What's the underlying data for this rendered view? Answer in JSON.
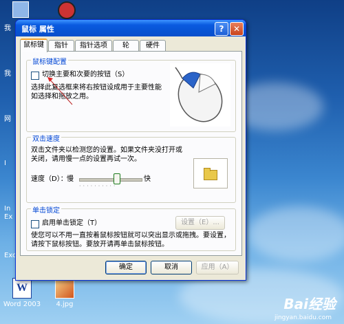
{
  "dialog": {
    "title": "鼠标 属性",
    "help_icon": "?",
    "close_icon": "✕"
  },
  "tabs": [
    {
      "label": "鼠标键",
      "active": true
    },
    {
      "label": "指针"
    },
    {
      "label": "指针选项"
    },
    {
      "label": "轮"
    },
    {
      "label": "硬件"
    }
  ],
  "button_config": {
    "group_title": "鼠标键配置",
    "checkbox_label": "切换主要和次要的按钮（S）",
    "description": "选择此复选框来将右按钮设成用于主要性能如选择和拖放之用。"
  },
  "double_click": {
    "group_title": "双击速度",
    "description": "双击文件夹以检测您的设置。如果文件夹没打开或关闭，请用慢一点的设置再试一次。",
    "speed_label": "速度（D）：",
    "slow_label": "慢",
    "fast_label": "快",
    "speed_value": 0.6
  },
  "click_lock": {
    "group_title": "单击锁定",
    "checkbox_label": "启用单击锁定（T）",
    "settings_button": "设置（E）...",
    "description": "使您可以不用一直按着鼠标按钮就可以突出显示或拖拽。要设置，请按下鼠标按钮。要放开请再单击鼠标按钮。"
  },
  "footer": {
    "ok": "确定",
    "cancel": "取消",
    "apply": "应用（A）"
  },
  "desktop": {
    "icons": [
      {
        "label": "Word 2003"
      },
      {
        "label": "4.jpg"
      }
    ],
    "left_letters": [
      "我",
      "我",
      "网",
      "I",
      "In",
      "Ex",
      "Exc"
    ],
    "watermark": "Bai经验",
    "watermark_sub": "jingyan.baidu.com"
  },
  "colors": {
    "title_blue": "#0a5ae0",
    "dialog_bg": "#ECE9D8",
    "group_title": "#0046d5"
  }
}
